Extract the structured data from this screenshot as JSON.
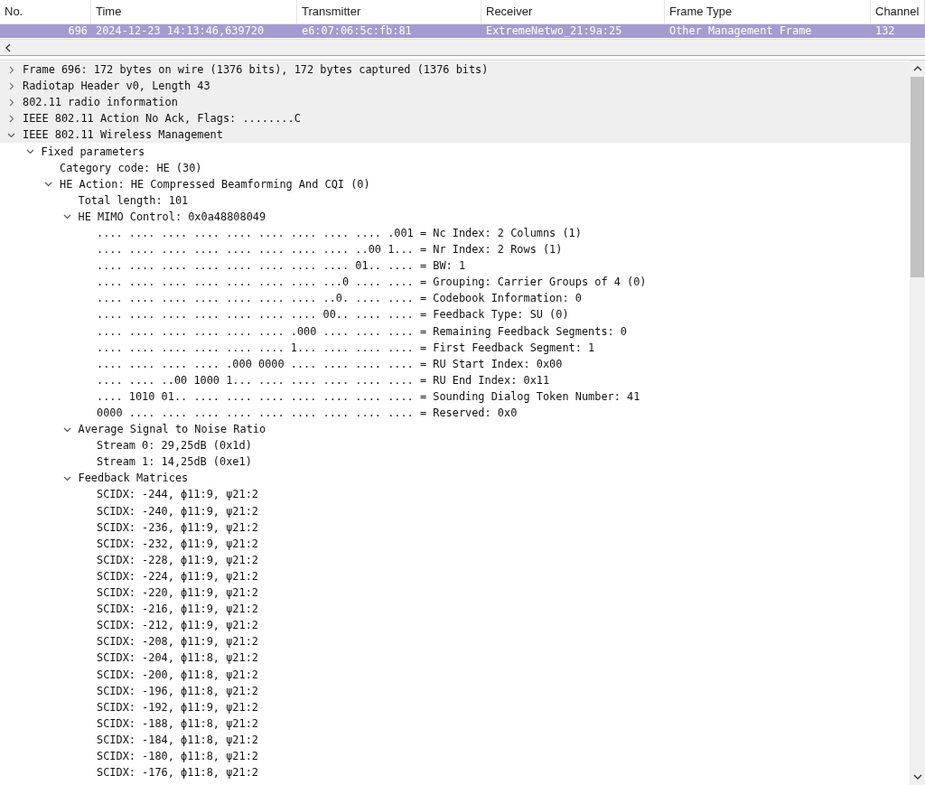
{
  "packet_list": {
    "columns": [
      "No.",
      "Time",
      "Transmitter",
      "Receiver",
      "Frame Type",
      "Channel"
    ],
    "rows": [
      {
        "selected": true,
        "cells": [
          "696",
          "2024-12-23 14:13:46,639720",
          "e6:07:06:5c:fb:81",
          "ExtremeNetwo_21:9a:25",
          "Other Management Frame",
          "132"
        ]
      }
    ]
  },
  "details": {
    "items": [
      {
        "label": "Frame 696: 172 bytes on wire (1376 bits), 172 bytes captured (1376 bits)",
        "expanded": false
      },
      {
        "label": "Radiotap Header v0, Length 43",
        "expanded": false
      },
      {
        "label": "802.11 radio information",
        "expanded": false
      },
      {
        "label": "IEEE 802.11 Action No Ack, Flags: ........C",
        "expanded": false
      },
      {
        "label": "IEEE 802.11 Wireless Management",
        "expanded": true,
        "children": [
          {
            "label": "Fixed parameters",
            "expanded": true,
            "children": [
              {
                "label": "Category code: HE (30)"
              },
              {
                "label": "HE Action: HE Compressed Beamforming And CQI (0)",
                "expanded": true,
                "children": [
                  {
                    "label": "Total length: 101"
                  },
                  {
                    "label": "HE MIMO Control: 0x0a48808049",
                    "expanded": true,
                    "children": [
                      {
                        "label": ".... .... .... .... .... .... .... .... .... .001 = Nc Index: 2 Columns (1)"
                      },
                      {
                        "label": ".... .... .... .... .... .... .... .... ..00 1... = Nr Index: 2 Rows (1)"
                      },
                      {
                        "label": ".... .... .... .... .... .... .... .... 01.. .... = BW: 1"
                      },
                      {
                        "label": ".... .... .... .... .... .... .... ...0 .... .... = Grouping: Carrier Groups of 4 (0)"
                      },
                      {
                        "label": ".... .... .... .... .... .... .... ..0. .... .... = Codebook Information: 0"
                      },
                      {
                        "label": ".... .... .... .... .... .... .... 00.. .... .... = Feedback Type: SU (0)"
                      },
                      {
                        "label": ".... .... .... .... .... .... .000 .... .... .... = Remaining Feedback Segments: 0"
                      },
                      {
                        "label": ".... .... .... .... .... .... 1... .... .... .... = First Feedback Segment: 1"
                      },
                      {
                        "label": ".... .... .... .... .000 0000 .... .... .... .... = RU Start Index: 0x00"
                      },
                      {
                        "label": ".... .... ..00 1000 1... .... .... .... .... .... = RU End Index: 0x11"
                      },
                      {
                        "label": ".... 1010 01.. .... .... .... .... .... .... .... = Sounding Dialog Token Number: 41"
                      },
                      {
                        "label": "0000 .... .... .... .... .... .... .... .... .... = Reserved: 0x0"
                      }
                    ]
                  },
                  {
                    "label": "Average Signal to Noise Ratio",
                    "expanded": true,
                    "children": [
                      {
                        "label": "Stream 0: 29,25dB (0x1d)"
                      },
                      {
                        "label": "Stream 1: 14,25dB (0xe1)"
                      }
                    ]
                  },
                  {
                    "label": "Feedback Matrices",
                    "expanded": true,
                    "children": [
                      {
                        "label": "SCIDX: -244, ϕ11:9, ψ21:2"
                      },
                      {
                        "label": "SCIDX: -240, ϕ11:9, ψ21:2"
                      },
                      {
                        "label": "SCIDX: -236, ϕ11:9, ψ21:2"
                      },
                      {
                        "label": "SCIDX: -232, ϕ11:9, ψ21:2"
                      },
                      {
                        "label": "SCIDX: -228, ϕ11:9, ψ21:2"
                      },
                      {
                        "label": "SCIDX: -224, ϕ11:9, ψ21:2"
                      },
                      {
                        "label": "SCIDX: -220, ϕ11:9, ψ21:2"
                      },
                      {
                        "label": "SCIDX: -216, ϕ11:9, ψ21:2"
                      },
                      {
                        "label": "SCIDX: -212, ϕ11:9, ψ21:2"
                      },
                      {
                        "label": "SCIDX: -208, ϕ11:9, ψ21:2"
                      },
                      {
                        "label": "SCIDX: -204, ϕ11:8, ψ21:2"
                      },
                      {
                        "label": "SCIDX: -200, ϕ11:8, ψ21:2"
                      },
                      {
                        "label": "SCIDX: -196, ϕ11:8, ψ21:2"
                      },
                      {
                        "label": "SCIDX: -192, ϕ11:9, ψ21:2"
                      },
                      {
                        "label": "SCIDX: -188, ϕ11:8, ψ21:2"
                      },
                      {
                        "label": "SCIDX: -184, ϕ11:8, ψ21:2"
                      },
                      {
                        "label": "SCIDX: -180, ϕ11:8, ψ21:2"
                      },
                      {
                        "label": "SCIDX: -176, ϕ11:8, ψ21:2"
                      }
                    ]
                  }
                ]
              }
            ]
          }
        ]
      }
    ]
  }
}
